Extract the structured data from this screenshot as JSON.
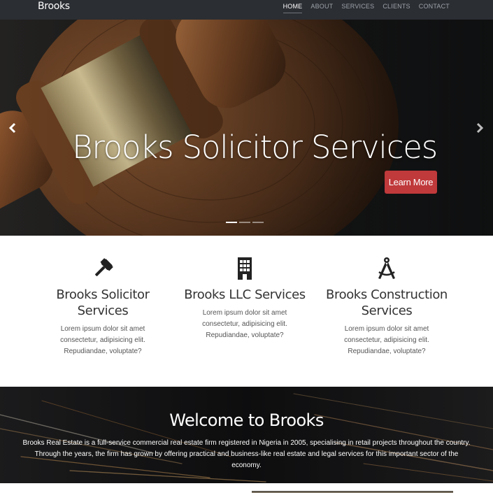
{
  "navbar": {
    "brand": "Brooks",
    "links": [
      "HOME",
      "ABOUT",
      "SERVICES",
      "CLIENTS",
      "CONTACT"
    ],
    "active": "HOME"
  },
  "hero": {
    "title": "Brooks Solicitor Services",
    "cta": "Learn More",
    "prev_icon": "chevron-left-icon",
    "next_icon": "chevron-right-icon",
    "slides": 3,
    "active_slide": 1
  },
  "services": [
    {
      "icon": "gavel-icon",
      "title": "Brooks Solicitor Services",
      "desc": "Lorem ipsum dolor sit amet consectetur, adipisicing elit. Repudiandae, voluptate?"
    },
    {
      "icon": "building-icon",
      "title": "Brooks LLC Services",
      "desc": "Lorem ipsum dolor sit amet consectetur, adipisicing elit. Repudiandae, voluptate?"
    },
    {
      "icon": "compass-icon",
      "title": "Brooks Construction Services",
      "desc": "Lorem ipsum dolor sit amet consectetur, adipisicing elit. Repudiandae, voluptate?"
    }
  ],
  "welcome": {
    "title": "Welcome to Brooks",
    "text": "Brooks Real Estate is a full-service commercial real estate firm registered in Nigeria in 2005, specialising in retail projects throughout the country. Through the years, the firm has grown by offering practical and business-like real estate and legal services for this important sector of the economy."
  },
  "colors": {
    "navbar": "#2b2e33",
    "accent": "#c0393b",
    "text": "#333333"
  }
}
